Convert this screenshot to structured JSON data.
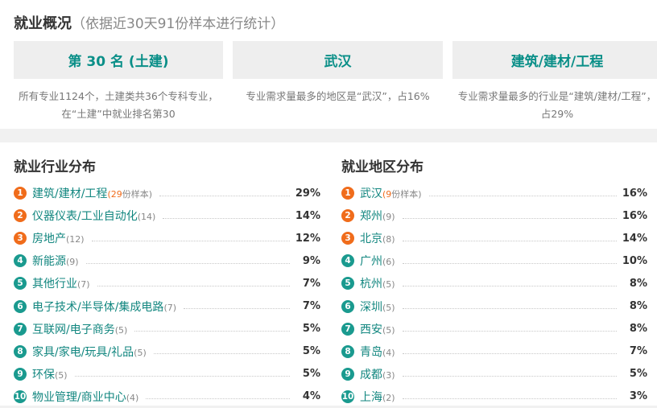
{
  "overview": {
    "title": "就业概况",
    "subtitle": "（依据近30天91份样本进行统计）",
    "cards": [
      {
        "headline": "第 30 名 (土建)",
        "desc": "所有专业1124个，土建类共36个专科专业，在“土建”中就业排名第30"
      },
      {
        "headline": "武汉",
        "desc": "专业需求量最多的地区是“武汉”，占16%"
      },
      {
        "headline": "建筑/建材/工程",
        "desc": "专业需求量最多的行业是“建筑/建材/工程”，占29%"
      }
    ]
  },
  "industry": {
    "title": "就业行业分布",
    "items": [
      {
        "rank": "1",
        "name": "建筑/建材/工程",
        "count": "(29",
        "count_suffix": "份样本)",
        "pct": "29%"
      },
      {
        "rank": "2",
        "name": "仪器仪表/工业自动化",
        "count": "(14)",
        "count_suffix": "",
        "pct": "14%"
      },
      {
        "rank": "3",
        "name": "房地产",
        "count": "(12)",
        "count_suffix": "",
        "pct": "12%"
      },
      {
        "rank": "4",
        "name": "新能源",
        "count": "(9)",
        "count_suffix": "",
        "pct": "9%"
      },
      {
        "rank": "5",
        "name": "其他行业",
        "count": "(7)",
        "count_suffix": "",
        "pct": "7%"
      },
      {
        "rank": "6",
        "name": "电子技术/半导体/集成电路",
        "count": "(7)",
        "count_suffix": "",
        "pct": "7%"
      },
      {
        "rank": "7",
        "name": "互联网/电子商务",
        "count": "(5)",
        "count_suffix": "",
        "pct": "5%"
      },
      {
        "rank": "8",
        "name": "家具/家电/玩具/礼品",
        "count": "(5)",
        "count_suffix": "",
        "pct": "5%"
      },
      {
        "rank": "9",
        "name": "环保",
        "count": "(5)",
        "count_suffix": "",
        "pct": "5%"
      },
      {
        "rank": "10",
        "name": "物业管理/商业中心",
        "count": "(4)",
        "count_suffix": "",
        "pct": "4%"
      }
    ]
  },
  "region": {
    "title": "就业地区分布",
    "items": [
      {
        "rank": "1",
        "name": "武汉",
        "count": "(9",
        "count_suffix": "份样本)",
        "pct": "16%"
      },
      {
        "rank": "2",
        "name": "郑州",
        "count": "(9)",
        "count_suffix": "",
        "pct": "16%"
      },
      {
        "rank": "3",
        "name": "北京",
        "count": "(8)",
        "count_suffix": "",
        "pct": "14%"
      },
      {
        "rank": "4",
        "name": "广州",
        "count": "(6)",
        "count_suffix": "",
        "pct": "10%"
      },
      {
        "rank": "5",
        "name": "杭州",
        "count": "(5)",
        "count_suffix": "",
        "pct": "8%"
      },
      {
        "rank": "6",
        "name": "深圳",
        "count": "(5)",
        "count_suffix": "",
        "pct": "8%"
      },
      {
        "rank": "7",
        "name": "西安",
        "count": "(5)",
        "count_suffix": "",
        "pct": "8%"
      },
      {
        "rank": "8",
        "name": "青岛",
        "count": "(4)",
        "count_suffix": "",
        "pct": "7%"
      },
      {
        "rank": "9",
        "name": "成都",
        "count": "(3)",
        "count_suffix": "",
        "pct": "5%"
      },
      {
        "rank": "10",
        "name": "上海",
        "count": "(2)",
        "count_suffix": "",
        "pct": "3%"
      }
    ]
  },
  "colors": {
    "accent": "#0a8f88",
    "link": "#11867f",
    "top_badge": "#f06c1b",
    "rest_badge": "#1a9a8f"
  }
}
